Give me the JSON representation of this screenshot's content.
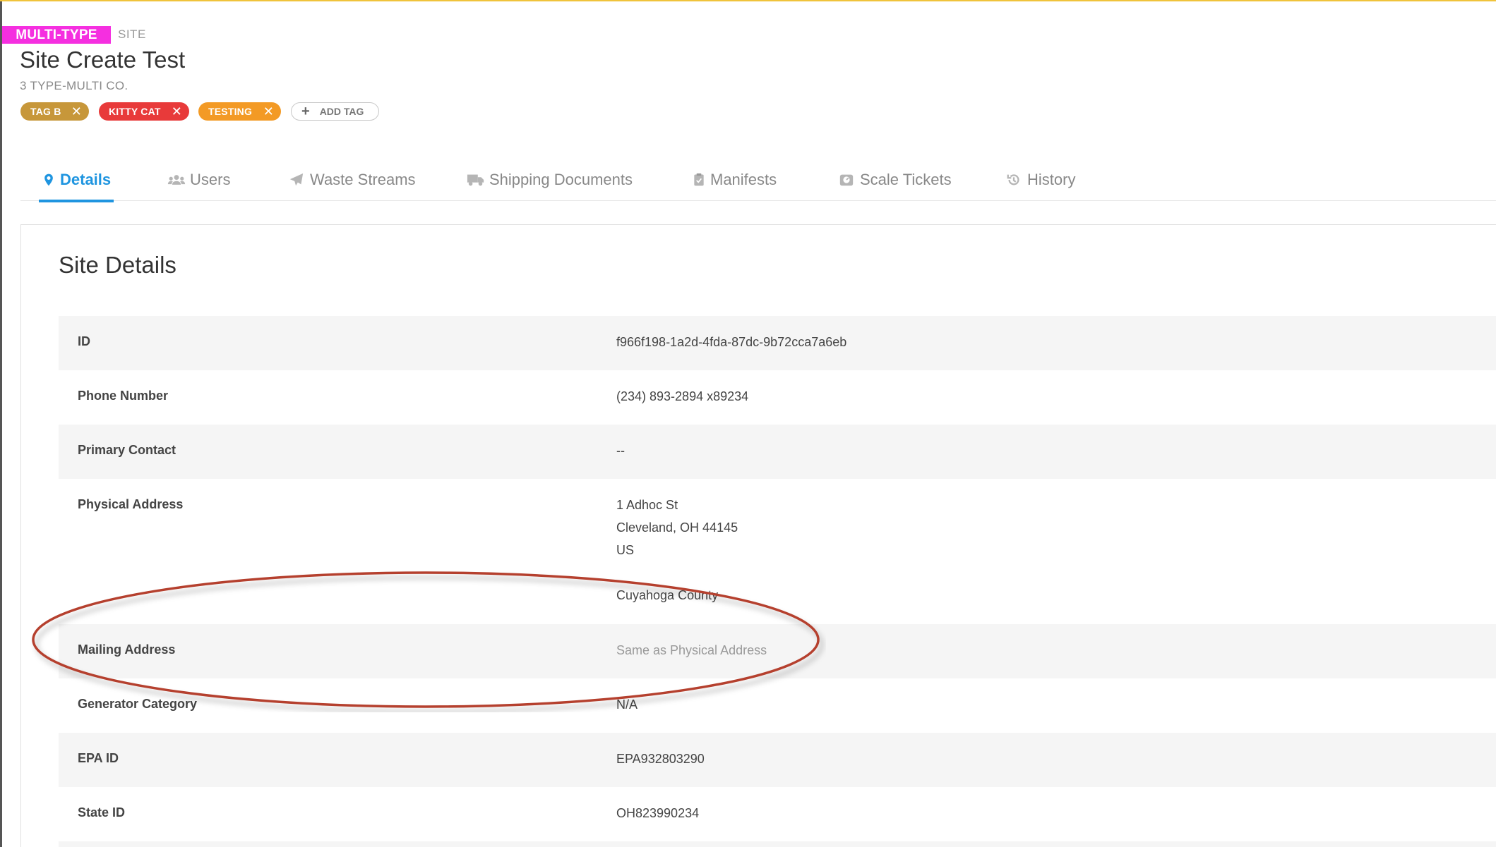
{
  "header": {
    "type_badge": "MULTI-TYPE",
    "type_label": "SITE",
    "title": "Site Create Test",
    "company": "3 TYPE-MULTI CO."
  },
  "tags": [
    {
      "label": "TAG B",
      "color": "#c7973a"
    },
    {
      "label": "KITTY CAT",
      "color": "#e83a3a"
    },
    {
      "label": "TESTING",
      "color": "#f39a25"
    }
  ],
  "add_tag_label": "ADD TAG",
  "tabs": [
    {
      "label": "Details",
      "icon": "map-pin-icon",
      "active": true
    },
    {
      "label": "Users",
      "icon": "users-icon",
      "active": false
    },
    {
      "label": "Waste Streams",
      "icon": "paper-plane-icon",
      "active": false
    },
    {
      "label": "Shipping Documents",
      "icon": "truck-icon",
      "active": false
    },
    {
      "label": "Manifests",
      "icon": "clipboard-check-icon",
      "active": false
    },
    {
      "label": "Scale Tickets",
      "icon": "scale-icon",
      "active": false
    },
    {
      "label": "History",
      "icon": "history-icon",
      "active": false
    }
  ],
  "card_title": "Site Details",
  "details": [
    {
      "label": "ID",
      "value": "f966f198-1a2d-4fda-87dc-9b72cca7a6eb"
    },
    {
      "label": "Phone Number",
      "value": "(234) 893-2894 x89234"
    },
    {
      "label": "Primary Contact",
      "value": "--"
    },
    {
      "label": "Physical Address",
      "lines": [
        "1 Adhoc St",
        "Cleveland, OH 44145",
        "US",
        "",
        "Cuyahoga County"
      ]
    },
    {
      "label": "Mailing Address",
      "value": "Same as Physical Address"
    },
    {
      "label": "Generator Category",
      "value": "N/A"
    },
    {
      "label": "EPA ID",
      "value": "EPA932803290"
    },
    {
      "label": "State ID",
      "value": "OH823990234"
    }
  ],
  "colors": {
    "accent": "#1f95e0",
    "badge": "#f52fe0",
    "highlight_ellipse": "#b5412f"
  }
}
